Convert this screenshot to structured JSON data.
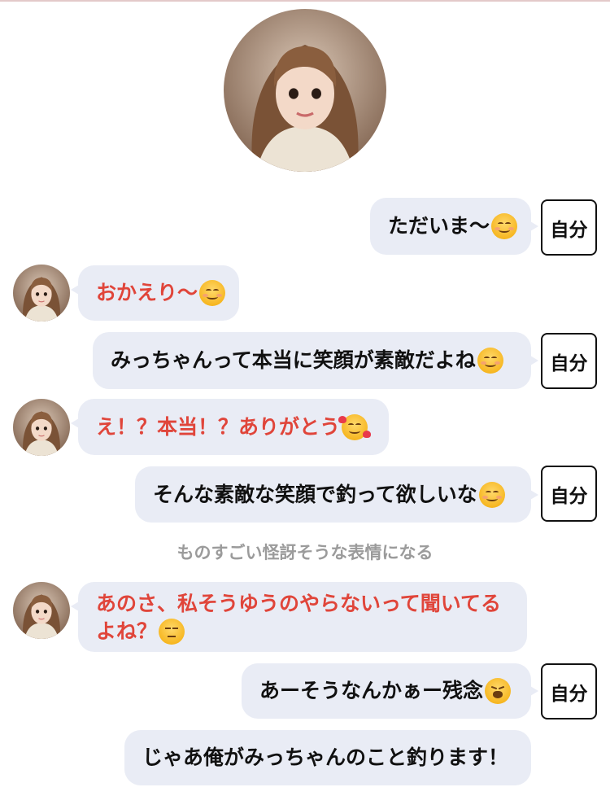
{
  "self_label": "自分",
  "narration": "ものすごい怪訝そうな表情になる",
  "messages": [
    {
      "side": "right",
      "text": "ただいま〜",
      "emoji": "smile-emoji",
      "self": true
    },
    {
      "side": "left",
      "text": "おかえり〜",
      "emoji": "smile-emoji"
    },
    {
      "side": "right",
      "text": "みっちゃんって本当に笑顔が素敵だよね",
      "emoji": "smile-emoji",
      "self": true
    },
    {
      "side": "left",
      "text": "え！？本当！？ありがとう",
      "emoji": "smiling-face-with-hearts-emoji"
    },
    {
      "side": "right",
      "text": "そんな素敵な笑顔で釣って欲しいな",
      "emoji": "smile-emoji",
      "self": true
    },
    {
      "side": "left",
      "text_line1": "あのさ、私そうゆうのやらないって聞いてる",
      "text_line2": "よね？",
      "emoji": "unamused-face-emoji"
    },
    {
      "side": "right",
      "text": "あーそうなんかぁー残念",
      "emoji": "weary-face-emoji",
      "self": true
    },
    {
      "side": "right",
      "text": "じゃあ俺がみっちゃんのこと釣ります！",
      "self": false
    }
  ],
  "colors": {
    "bubble_bg": "#e9ecf5",
    "partner_text": "#e0453a",
    "self_text": "#111111",
    "narration_text": "#9b9b9b"
  }
}
